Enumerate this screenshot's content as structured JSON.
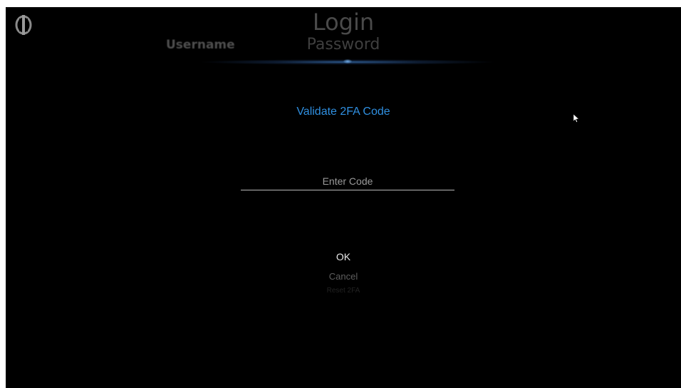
{
  "header": {
    "title": "Login",
    "tabs": [
      {
        "label": "Username"
      },
      {
        "label": "Password"
      }
    ]
  },
  "dialog": {
    "title": "Validate 2FA Code",
    "code_field": {
      "value": "",
      "placeholder": "Enter Code"
    },
    "buttons": {
      "ok": "OK",
      "cancel": "Cancel",
      "reset": "Reset 2FA"
    }
  },
  "colors": {
    "background": "#000000",
    "accent": "#2f8fe0",
    "text_primary": "#e8e8e8",
    "text_dim": "#5e5e5e"
  },
  "icons": {
    "logo": "app-logo-icon",
    "pointer": "mouse-cursor-icon"
  }
}
